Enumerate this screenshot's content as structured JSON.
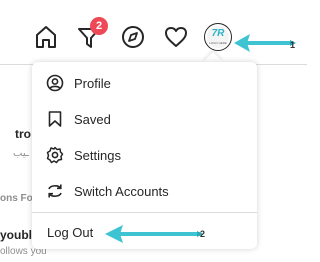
{
  "nav": {
    "icons": [
      "home-icon",
      "activity-icon",
      "explore-icon",
      "heart-icon"
    ],
    "badge_count": "2",
    "avatar_mark": "7R",
    "avatar_sub": "LOGO HERE"
  },
  "background": {
    "line1": "tro",
    "line2": "ـيب",
    "line3": "ons Fo",
    "line4": "youbl",
    "line5": "ollows you"
  },
  "menu": {
    "items": [
      {
        "label": "Profile",
        "icon": "profile-icon"
      },
      {
        "label": "Saved",
        "icon": "bookmark-icon"
      },
      {
        "label": "Settings",
        "icon": "settings-icon"
      },
      {
        "label": "Switch Accounts",
        "icon": "switch-accounts-icon"
      }
    ],
    "logout_label": "Log Out"
  },
  "annotations": {
    "arrow1_number": "1",
    "arrow2_number": "2",
    "arrow_color": "#3ec3d3"
  },
  "colors": {
    "badge": "#ed4956",
    "text": "#262626",
    "border": "#dbdbdb"
  }
}
